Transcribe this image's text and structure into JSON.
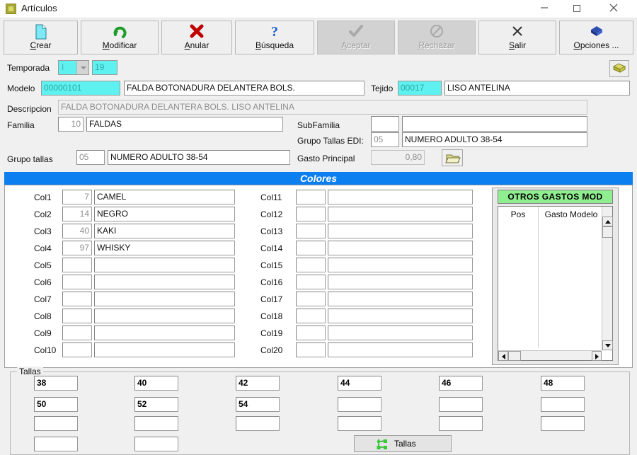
{
  "window": {
    "title": "Artículos",
    "icon": "app-icon",
    "minimize": "—",
    "maximize": "□",
    "close": "✕"
  },
  "toolbar": {
    "buttons": [
      {
        "label": "Crear",
        "accel": "C",
        "icon": "new-document-icon",
        "disabled": false
      },
      {
        "label": "Modificar",
        "accel": "M",
        "icon": "undo-arrow-icon",
        "disabled": false
      },
      {
        "label": "Anular",
        "accel": "A",
        "icon": "red-x-icon",
        "disabled": false
      },
      {
        "label": "Búsqueda",
        "accel": "B",
        "icon": "question-mark-icon",
        "disabled": false
      },
      {
        "label": "Aceptar",
        "accel": "A",
        "icon": "checkmark-icon",
        "disabled": true
      },
      {
        "label": "Rechazar",
        "accel": "R",
        "icon": "no-entry-icon",
        "disabled": true
      },
      {
        "label": "Salir",
        "accel": "S",
        "icon": "x-close-icon",
        "disabled": false
      },
      {
        "label": "Opciones ...",
        "accel": "O",
        "icon": "blue-box-icon",
        "disabled": false
      }
    ]
  },
  "form": {
    "temporada_label": "Temporada",
    "temporada_letra": "I",
    "temporada_anyo": "19",
    "modelo_label": "Modelo",
    "modelo_codigo": "00000101",
    "modelo_nombre": "FALDA BOTONADURA DELANTERA BOLS.",
    "tejido_label": "Tejido",
    "tejido_codigo": "00017",
    "tejido_nombre": "LISO ANTELINA",
    "descripcion_label": "Descripcion",
    "descripcion_valor": "FALDA BOTONADURA DELANTERA BOLS. LISO ANTELINA",
    "familia_label": "Familia",
    "familia_codigo": "10",
    "familia_nombre": "FALDAS",
    "subfamilia_label": "SubFamilia",
    "subfamilia_codigo": "",
    "subfamilia_nombre": "",
    "grupo_tallas_label": "Grupo tallas",
    "grupo_tallas_codigo": "05",
    "grupo_tallas_nombre": "NUMERO ADULTO 38-54",
    "grupo_tallas_edi_label": "Grupo Tallas EDI:",
    "grupo_tallas_edi_codigo": "05",
    "grupo_tallas_edi_nombre": "NUMERO ADULTO 38-54",
    "gasto_principal_label": "Gasto Principal",
    "gasto_principal_valor": "0,80",
    "gasto_principal_icon": "folder-open-icon",
    "top_right_icon": "yellow-box-icon"
  },
  "colores": {
    "title": "Colores",
    "left": [
      {
        "label": "Col1",
        "codigo": "7",
        "nombre": "CAMEL"
      },
      {
        "label": "Col2",
        "codigo": "14",
        "nombre": "NEGRO"
      },
      {
        "label": "Col3",
        "codigo": "40",
        "nombre": "KAKI"
      },
      {
        "label": "Col4",
        "codigo": "97",
        "nombre": "WHISKY"
      },
      {
        "label": "Col5",
        "codigo": "",
        "nombre": ""
      },
      {
        "label": "Col6",
        "codigo": "",
        "nombre": ""
      },
      {
        "label": "Col7",
        "codigo": "",
        "nombre": ""
      },
      {
        "label": "Col8",
        "codigo": "",
        "nombre": ""
      },
      {
        "label": "Col9",
        "codigo": "",
        "nombre": ""
      },
      {
        "label": "Col10",
        "codigo": "",
        "nombre": ""
      }
    ],
    "right": [
      {
        "label": "Col11",
        "codigo": "",
        "nombre": ""
      },
      {
        "label": "Col12",
        "codigo": "",
        "nombre": ""
      },
      {
        "label": "Col13",
        "codigo": "",
        "nombre": ""
      },
      {
        "label": "Col14",
        "codigo": "",
        "nombre": ""
      },
      {
        "label": "Col15",
        "codigo": "",
        "nombre": ""
      },
      {
        "label": "Col16",
        "codigo": "",
        "nombre": ""
      },
      {
        "label": "Col17",
        "codigo": "",
        "nombre": ""
      },
      {
        "label": "Col18",
        "codigo": "",
        "nombre": ""
      },
      {
        "label": "Col19",
        "codigo": "",
        "nombre": ""
      },
      {
        "label": "Col20",
        "codigo": "",
        "nombre": ""
      }
    ]
  },
  "otros_gastos": {
    "header": "OTROS GASTOS MOD",
    "columns": [
      "Pos",
      "Gasto Modelo"
    ],
    "rows": []
  },
  "tallas": {
    "caption": "Tallas",
    "values": [
      "38",
      "40",
      "42",
      "44",
      "46",
      "48",
      "50",
      "52",
      "54",
      "",
      "",
      "",
      "",
      "",
      "",
      "",
      "",
      "",
      "",
      "",
      "",
      "",
      "",
      ""
    ],
    "button_label": "Tallas",
    "button_icon": "network-nodes-icon"
  },
  "colors": {
    "accent_blue": "#0b7ff0",
    "cyan_field": "#5ff0f0",
    "green_header": "#90ee90",
    "window_bg": "#f0f0f0"
  }
}
